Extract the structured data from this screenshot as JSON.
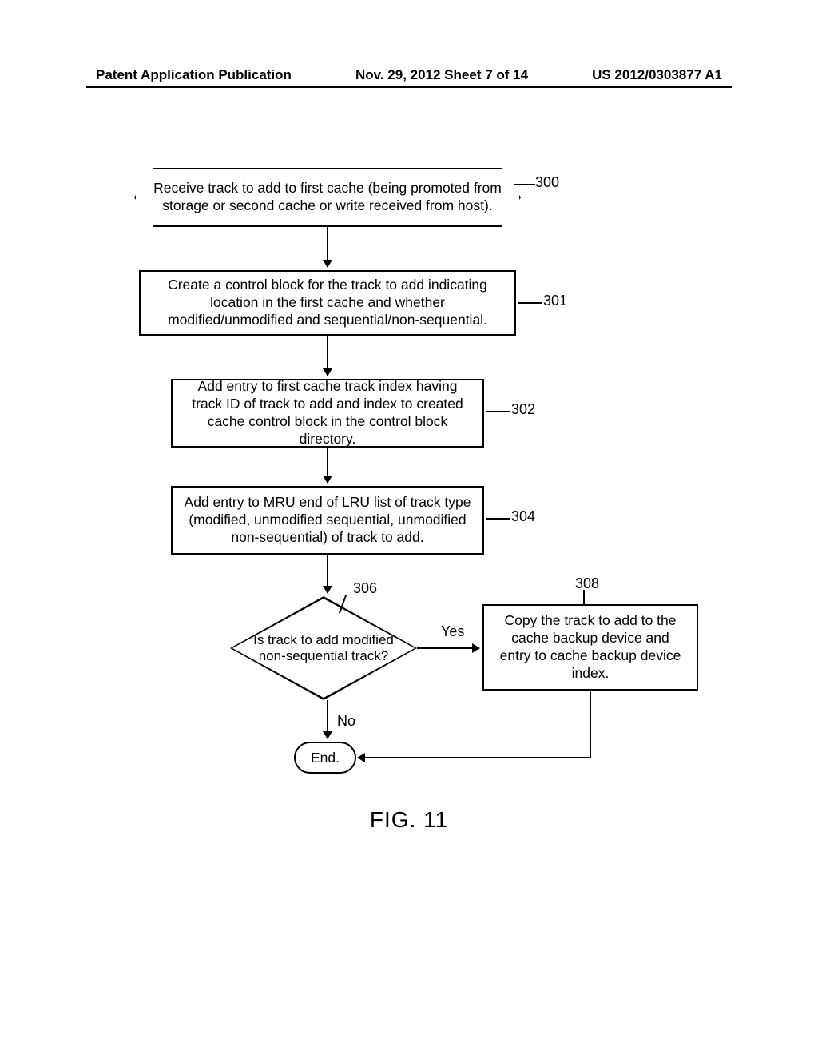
{
  "header": {
    "left": "Patent Application Publication",
    "mid": "Nov. 29, 2012  Sheet 7 of 14",
    "right": "US 2012/0303877 A1"
  },
  "nodes": {
    "n300": "Receive track to add to first cache (being promoted from storage or second cache or write received from host).",
    "n301": "Create a control block for the track to add indicating location in the first cache and whether modified/unmodified and sequential/non-sequential.",
    "n302": "Add entry to first cache track index having track ID of track to add and index to created cache control block in the control block directory.",
    "n304": "Add entry to MRU end of LRU list of track type (modified, unmodified sequential, unmodified non-sequential) of track to add.",
    "n306": "Is track to add modified non-sequential track?",
    "n308": "Copy the track to add to the cache backup device and entry to cache backup device index.",
    "end": "End."
  },
  "labels": {
    "l300": "300",
    "l301": "301",
    "l302": "302",
    "l304": "304",
    "l306": "306",
    "l308": "308",
    "yes": "Yes",
    "no": "No"
  },
  "caption": "FIG. 11"
}
